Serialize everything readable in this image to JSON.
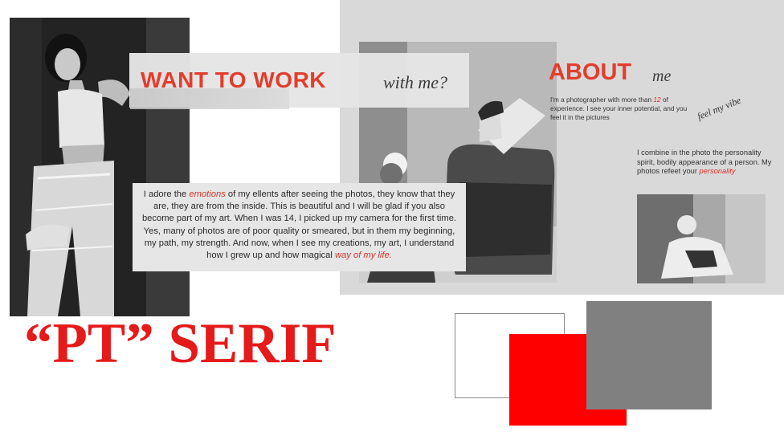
{
  "banner": {
    "title": "WANT TO WORK",
    "subtitle": "with me?"
  },
  "paragraph": {
    "p1": "I adore the ",
    "emotions": "emotions",
    "p2": " of my ellents after seeing the photos, they know that they are, they are from the inside. This is beautiful and I will be glad if you also become part of my art. When I was 14, I picked up my camera for the first time. Yes, many of photos are of poor quality or smeared, but in them my beginning, my path, my strength. And now, when I see my creations, my art, I understand how I grew up and how magical ",
    "way_of_my_life": "way of my life."
  },
  "about": {
    "title": "ABOUT",
    "subtitle": "me",
    "text1_a": "I'm a photographer with more than ",
    "text1_num": "12",
    "text1_b": " of experience. I see your inner potential, and you feel it in the pictures",
    "signature": "feel my vibe",
    "text2_a": "I combine in the photo the personality spirit, bodily appearance of a person. My photos refeet your ",
    "text2_red": "personality"
  },
  "font_title": "“PT” SERIF",
  "palette": {
    "white": "#ffffff",
    "red": "#ff0000",
    "gray": "#808080",
    "accent": "#e23d2d"
  }
}
